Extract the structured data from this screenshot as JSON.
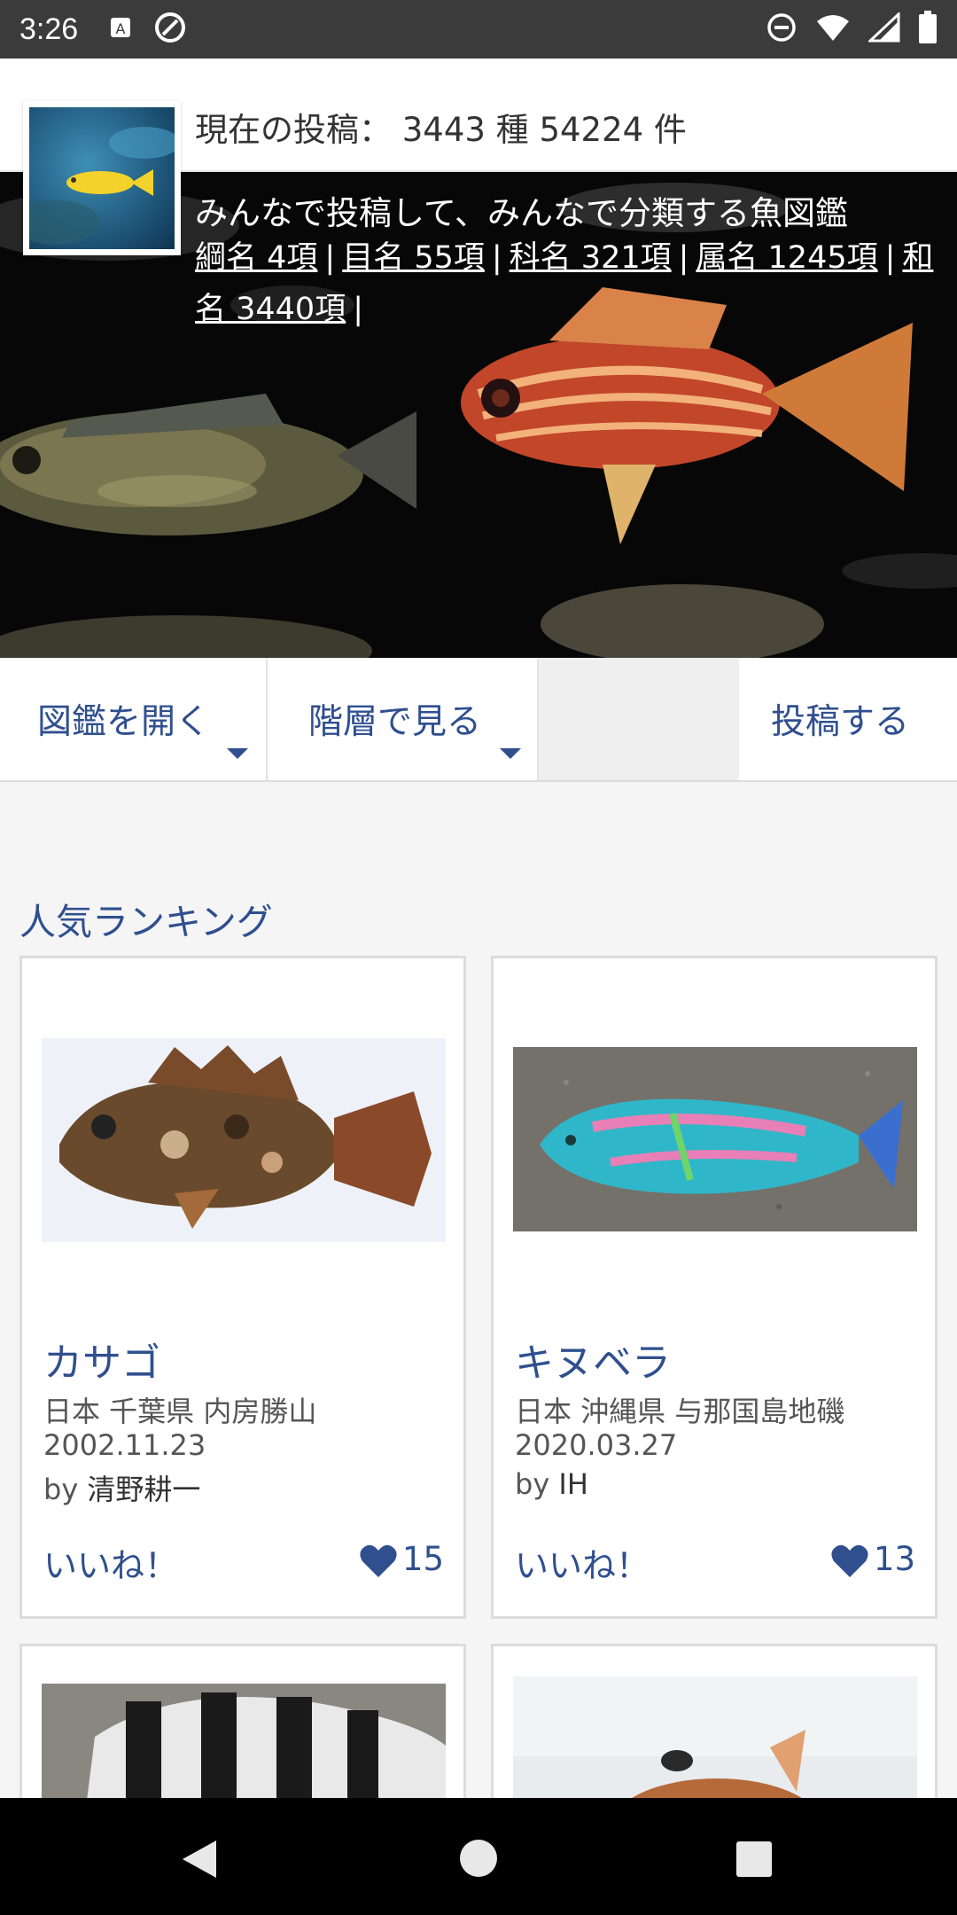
{
  "status": {
    "time": "3:26"
  },
  "header": {
    "count_text": "現在の投稿： 3443 種 54224 件"
  },
  "hero": {
    "tagline": "みんなで投稿して、みんなで分類する魚図鑑",
    "stats": [
      {
        "label": "綱名 4項"
      },
      {
        "label": "目名 55項"
      },
      {
        "label": "科名 321項"
      },
      {
        "label": "属名 1245項"
      },
      {
        "label": "和名 3440項"
      }
    ]
  },
  "nav": {
    "open_zukan": "図鑑を開く",
    "hierarchy": "階層で見る",
    "post": "投稿する"
  },
  "section": {
    "title": "人気ランキング"
  },
  "cards": [
    {
      "name": "カサゴ",
      "location": "日本 千葉県 内房勝山",
      "date": "2002.11.23",
      "by_prefix": "by ",
      "author": "清野耕一",
      "like_label": "いいね！",
      "likes": "15"
    },
    {
      "name": "キヌベラ",
      "location": "日本 沖縄県 与那国島地磯",
      "date": "2020.03.27",
      "by_prefix": "by ",
      "author": "IH",
      "like_label": "いいね！",
      "likes": "13"
    }
  ],
  "colors": {
    "accent": "#2f4f8f",
    "hero_bg": "#070707",
    "status_bar": "#3b3b3b"
  },
  "icons": [
    "key-a-icon",
    "sync-icon",
    "dnd-icon",
    "wifi-icon",
    "signal-icon",
    "battery-icon",
    "heart-icon",
    "back-icon",
    "home-icon",
    "recents-icon"
  ]
}
